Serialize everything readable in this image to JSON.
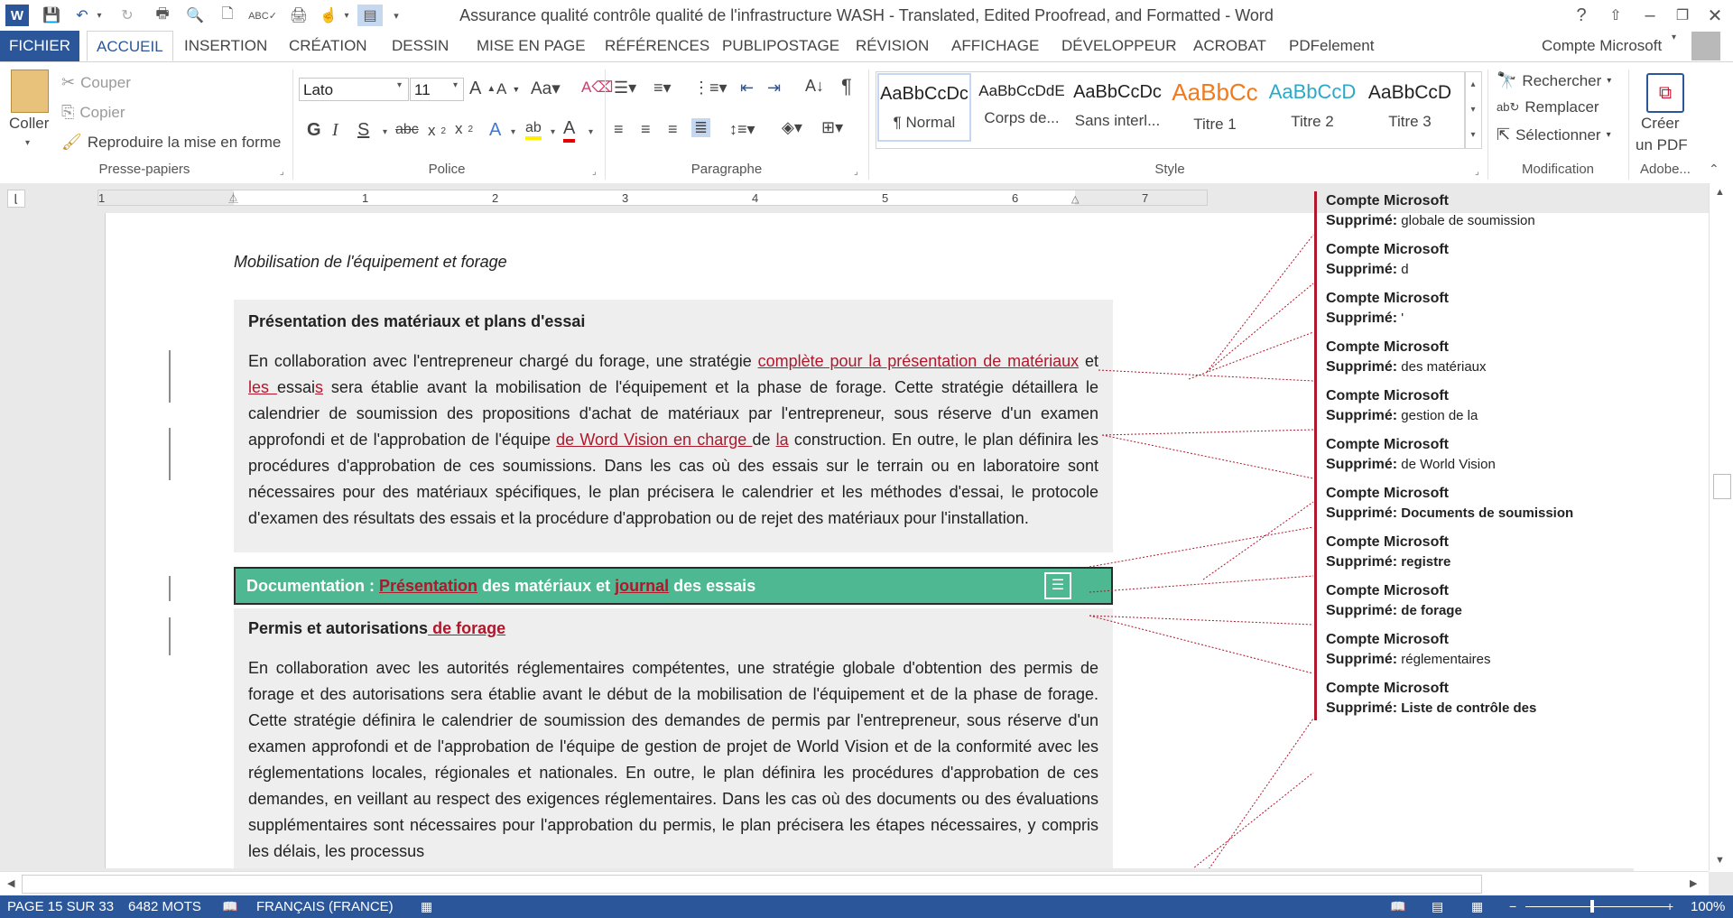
{
  "window": {
    "title": "Assurance qualité  contrôle qualité de l'infrastructure WASH - Translated, Edited Proofread, and Formatted - Word",
    "help": "?"
  },
  "tabs": [
    "FICHIER",
    "ACCUEIL",
    "INSERTION",
    "CRÉATION",
    "DESSIN",
    "MISE EN PAGE",
    "RÉFÉRENCES",
    "PUBLIPOSTAGE",
    "RÉVISION",
    "AFFICHAGE",
    "DÉVELOPPEUR",
    "ACROBAT",
    "PDFelement"
  ],
  "account": "Compte Microsoft",
  "ribbon": {
    "clipboard": {
      "paste": "Coller",
      "cut": "Couper",
      "copy": "Copier",
      "format_painter": "Reproduire la mise en forme",
      "label": "Presse-papiers"
    },
    "font": {
      "name": "Lato",
      "size": "11",
      "label": "Police"
    },
    "paragraph": {
      "label": "Paragraphe"
    },
    "styles": {
      "label": "Style",
      "items": [
        {
          "preview": "AaBbCcDc",
          "name": "¶ Normal",
          "color": "#222222"
        },
        {
          "preview": "AaBbCcDdE",
          "name": "Corps de...",
          "color": "#222222"
        },
        {
          "preview": "AaBbCcDc",
          "name": "Sans interl...",
          "color": "#222222"
        },
        {
          "preview": "AaBbCc",
          "name": "Titre 1",
          "color": "#f07a1e"
        },
        {
          "preview": "AaBbCcD",
          "name": "Titre 2",
          "color": "#2aa9c9"
        },
        {
          "preview": "AaBbCcD",
          "name": "Titre 3",
          "color": "#222222"
        }
      ]
    },
    "editing": {
      "find": "Rechercher",
      "replace": "Remplacer",
      "select": "Sélectionner",
      "label": "Modification"
    },
    "adobe": {
      "create": "Créer",
      "create2": "un PDF",
      "label": "Adobe..."
    }
  },
  "ruler": [
    "1",
    "1",
    "2",
    "3",
    "4",
    "5",
    "6",
    "7"
  ],
  "document": {
    "heading_italic": "Mobilisation de l'équipement et forage",
    "section1_title": "Présentation des matériaux et plans d'essai",
    "p1": {
      "t1": "En collaboration avec l'entrepreneur chargé du forage, une stratégie ",
      "i1": "complète pour la présentation de matériaux",
      "t2": " et ",
      "i2": "les ",
      "t3": "essai",
      "i3": "s",
      "t4": " sera établie avant la mobilisation de l'équipement et la phase de forage. Cette stratégie détaillera le calendrier de soumission des propositions d'achat de matériaux par l'entrepreneur, sous réserve d'un examen approfondi et de l'approbation de l'équipe ",
      "i4": "de Word Vision en charge ",
      "t5": "de ",
      "i5": "la",
      "t6": " construction. En outre, le plan définira les procédures d'approbation de ces soumissions. Dans les cas où des essais sur le terrain ou en laboratoire sont nécessaires pour des matériaux spécifiques, le plan précisera le calendrier et les méthodes d'essai, le protocole d'examen des résultats des essais et la procédure d'approbation ou de rejet des matériaux pour l'installation."
    },
    "doc_bar": {
      "t1": "Documentation : ",
      "i1": "Présentation",
      "t2": " des matériaux et ",
      "i2": "journal",
      "t3": " des essais"
    },
    "section2_title": {
      "t1": "Permis et autorisations",
      "i1": " de forage"
    },
    "p2": "En collaboration avec les autorités réglementaires compétentes, une stratégie globale d'obtention des permis de forage et des autorisations sera établie avant le début de la mobilisation de l'équipement et de la phase de forage. Cette stratégie définira le calendrier de soumission des demandes de permis par l'entrepreneur, sous réserve d'un examen approfondi et de l'approbation de l'équipe de gestion de projet de World Vision et de la conformité avec les réglementations locales, régionales et nationales. En outre, le plan définira les procédures d'approbation de ces demandes, en veillant au respect des exigences réglementaires. Dans les cas où des documents ou des évaluations supplémentaires sont nécessaires pour l'approbation du permis, le plan précisera les étapes nécessaires, y compris les délais, les processus"
  },
  "balloons": [
    {
      "author": "Compte Microsoft",
      "label": "Supprimé:",
      "text": "globale de soumission",
      "bold": false
    },
    {
      "author": "Compte Microsoft",
      "label": "Supprimé:",
      "text": "d",
      "bold": false
    },
    {
      "author": "Compte Microsoft",
      "label": "Supprimé:",
      "text": "'",
      "bold": false
    },
    {
      "author": "Compte Microsoft",
      "label": "Supprimé:",
      "text": "des matériaux",
      "bold": false
    },
    {
      "author": "Compte Microsoft",
      "label": "Supprimé:",
      "text": "gestion de la",
      "bold": false
    },
    {
      "author": "Compte Microsoft",
      "label": "Supprimé:",
      "text": " de World Vision",
      "bold": false
    },
    {
      "author": "Compte Microsoft",
      "label": "Supprimé:",
      "text": "Documents de soumission",
      "bold": true
    },
    {
      "author": "Compte Microsoft",
      "label": "Supprimé:",
      "text": "registre",
      "bold": true
    },
    {
      "author": "Compte Microsoft",
      "label": "Supprimé:",
      "text": " de forage",
      "bold": true
    },
    {
      "author": "Compte Microsoft",
      "label": "Supprimé:",
      "text": " réglementaires",
      "bold": false
    },
    {
      "author": "Compte Microsoft",
      "label": "Supprimé:",
      "text": "Liste de contrôle des",
      "bold": true
    }
  ],
  "status": {
    "page": "PAGE 15 SUR 33",
    "words": "6482 MOTS",
    "language": "FRANÇAIS (FRANCE)",
    "zoom": "100%"
  },
  "colors": {
    "accent": "#2b579a",
    "revision": "#b0172b",
    "doc_bar": "#4db891"
  }
}
